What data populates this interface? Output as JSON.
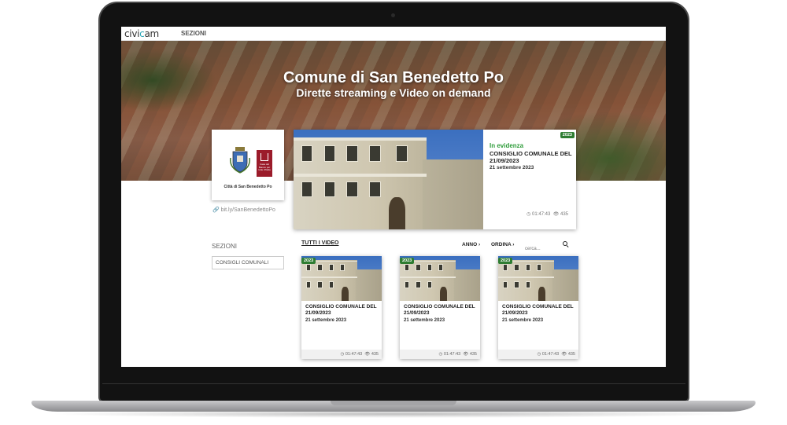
{
  "site": {
    "logo_text_1": "civi",
    "logo_text_accent": "c",
    "logo_text_2": "am",
    "nav_sezioni": "SEZIONI"
  },
  "hero": {
    "title": "Comune di San Benedetto Po",
    "subtitle": "Dirette streaming e Video on demand"
  },
  "municipality": {
    "caption": "Città di San Benedetto Po",
    "emblem_text": "Casa del Bianco per tutte d'Italia",
    "short_link": "bit.ly/SanBenedettoPo"
  },
  "featured": {
    "badge": "2023",
    "label": "In evidenza",
    "title": "CONSIGLIO COMUNALE DEL 21/09/2023",
    "date": "21 settembre 2023",
    "duration": "01:47:43",
    "views": "435"
  },
  "sidebar": {
    "label": "SEZIONI",
    "items": [
      {
        "label": "CONSIGLI COMUNALI"
      }
    ]
  },
  "filters": {
    "all_videos": "TUTTI I VIDEO",
    "year": "ANNO",
    "sort": "ORDINA",
    "search_placeholder": "cerca..."
  },
  "videos": [
    {
      "badge": "2023",
      "title": "CONSIGLIO COMUNALE DEL 21/09/2023",
      "date": "21 settembre 2023",
      "duration": "01:47:43",
      "views": "435"
    },
    {
      "badge": "2023",
      "title": "CONSIGLIO COMUNALE DEL 21/09/2023",
      "date": "21 settembre 2023",
      "duration": "01:47:43",
      "views": "435"
    },
    {
      "badge": "2023",
      "title": "CONSIGLIO COMUNALE DEL 21/09/2023",
      "date": "21 settembre 2023",
      "duration": "01:47:43",
      "views": "435"
    }
  ],
  "icons": {
    "link": "link-icon",
    "clock": "clock-icon",
    "eye": "eye-icon",
    "chevron": "chevron-right-icon",
    "search": "search-icon"
  },
  "colors": {
    "badge_green": "#2e7d32",
    "accent_teal": "#2aa7b8",
    "emblem_red": "#9b1b2a"
  }
}
